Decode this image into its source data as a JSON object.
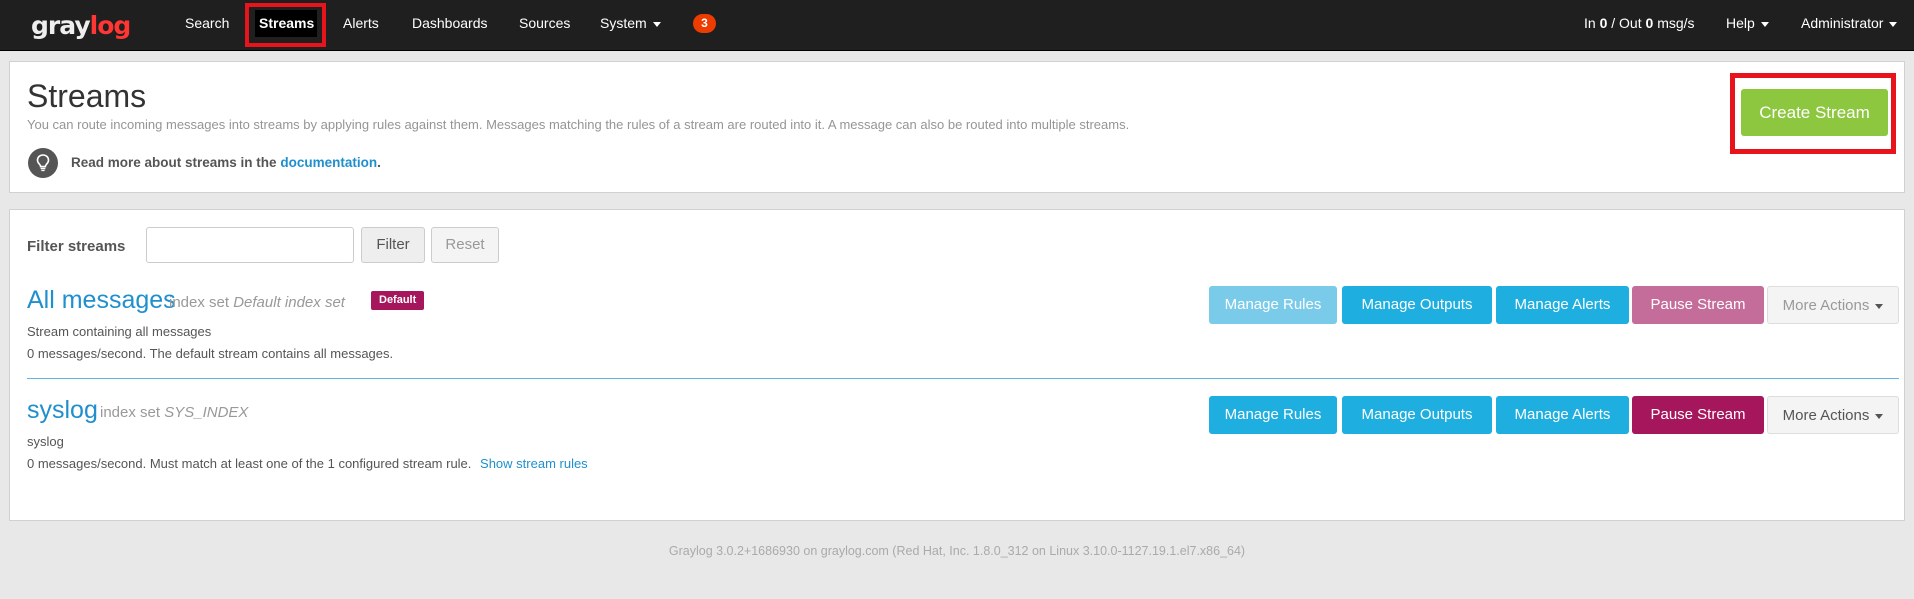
{
  "brand": {
    "text_gray": "gray",
    "text_log": "log"
  },
  "nav": {
    "items": [
      {
        "label": "Search"
      },
      {
        "label": "Streams"
      },
      {
        "label": "Alerts"
      },
      {
        "label": "Dashboards"
      },
      {
        "label": "Sources"
      },
      {
        "label": "System"
      }
    ],
    "notification_count": "3",
    "throughput": {
      "in_label": "In",
      "in_value": "0",
      "sep": "/ Out",
      "out_value": "0",
      "unit": "msg/s"
    },
    "help_label": "Help",
    "user_label": "Administrator"
  },
  "header": {
    "title": "Streams",
    "description": "You can route incoming messages into streams by applying rules against them. Messages matching the rules of a stream are routed into it. A message can also be routed into multiple streams.",
    "doc_hint_prefix": "Read more about streams in the",
    "doc_link": "documentation",
    "doc_hint_suffix": ".",
    "create_button": "Create Stream"
  },
  "filter": {
    "label": "Filter streams",
    "input_value": "",
    "filter_button": "Filter",
    "reset_button": "Reset"
  },
  "streams": [
    {
      "title": "All messages",
      "index_set_prefix": "index set",
      "index_set_name": "Default index set",
      "badge": "Default",
      "description": "Stream containing all messages",
      "stats": "0 messages/second. The default stream contains all messages.",
      "rules_link": "",
      "actions": {
        "manage_rules": "Manage Rules",
        "manage_outputs": "Manage Outputs",
        "manage_alerts": "Manage Alerts",
        "pause": "Pause Stream",
        "more": "More Actions"
      }
    },
    {
      "title": "syslog",
      "index_set_prefix": "index set",
      "index_set_name": "SYS_INDEX",
      "badge": "",
      "description": "syslog",
      "stats": "0 messages/second. Must match at least one of the 1 configured stream rule.",
      "rules_link": "Show stream rules",
      "actions": {
        "manage_rules": "Manage Rules",
        "manage_outputs": "Manage Outputs",
        "manage_alerts": "Manage Alerts",
        "pause": "Pause Stream",
        "more": "More Actions"
      }
    }
  ],
  "footer": "Graylog 3.0.2+1686930 on graylog.com (Red Hat, Inc. 1.8.0_312 on Linux 3.10.0-1127.19.1.el7.x86_64)",
  "colors": {
    "accent": "#1f8fce",
    "create": "#8dc63f",
    "primary": "#1faee0",
    "pause": "#a6165c",
    "highlight": "#e8141c"
  }
}
